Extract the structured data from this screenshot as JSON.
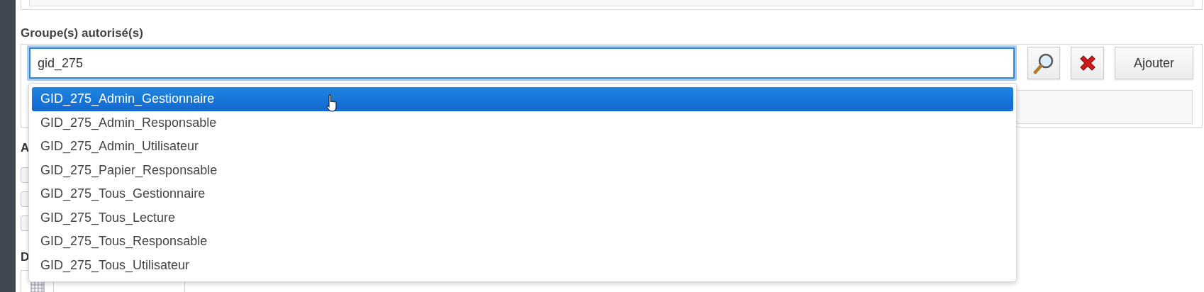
{
  "groups_field": {
    "label": "Groupe(s) autorisé(s)",
    "value": "gid_275",
    "buttons": [
      {
        "kind": "search"
      },
      {
        "kind": "clear"
      },
      {
        "kind": "text",
        "label": "Ajouter"
      }
    ]
  },
  "suggestions": [
    {
      "label": "GID_275_Admin_Gestionnaire",
      "selected": true
    },
    {
      "label": "GID_275_Admin_Responsable",
      "selected": false
    },
    {
      "label": "GID_275_Admin_Utilisateur",
      "selected": false
    },
    {
      "label": "GID_275_Papier_Responsable",
      "selected": false
    },
    {
      "label": "GID_275_Tous_Gestionnaire",
      "selected": false
    },
    {
      "label": "GID_275_Tous_Lecture",
      "selected": false
    },
    {
      "label": "GID_275_Tous_Responsable",
      "selected": false
    },
    {
      "label": "GID_275_Tous_Utilisateur",
      "selected": false
    }
  ],
  "hidden_section_labels": [
    "A",
    "D"
  ]
}
